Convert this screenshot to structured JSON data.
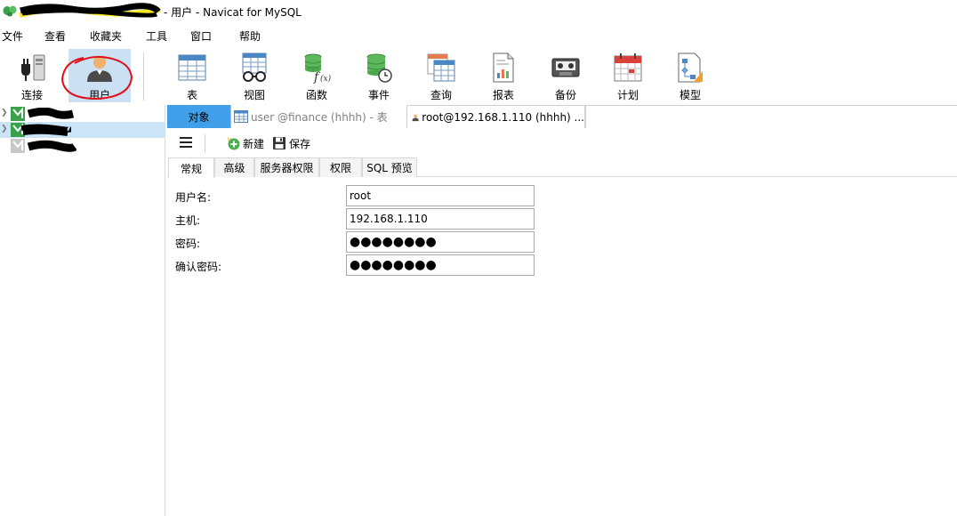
{
  "window": {
    "title_suffix": "- 用户 - Navicat for MySQL"
  },
  "menu": {
    "items": [
      "文件",
      "查看",
      "收藏夹",
      "工具",
      "窗口",
      "帮助"
    ]
  },
  "toolbar": {
    "connect": "连接",
    "user": "用户",
    "table": "表",
    "view": "视图",
    "function": "函数",
    "event": "事件",
    "query": "查询",
    "report": "报表",
    "backup": "备份",
    "schedule": "计划",
    "model": "模型"
  },
  "tabs": {
    "objects": "对象",
    "table_tab": "user @finance (hhhh) - 表",
    "user_tab": "root@192.168.1.110 (hhhh) ..."
  },
  "subtoolbar": {
    "new": "新建",
    "save": "保存"
  },
  "property_tabs": [
    "常规",
    "高级",
    "服务器权限",
    "权限",
    "SQL 预览"
  ],
  "form": {
    "username_label": "用户名:",
    "username_value": "root",
    "host_label": "主机:",
    "host_value": "192.168.1.110",
    "password_label": "密码:",
    "password_value": "●●●●●●●●",
    "confirm_label": "确认密码:",
    "confirm_value": "●●●●●●●●"
  },
  "colors": {
    "accent": "#42a0ea",
    "selected": "#cce0f4",
    "redaction": "#000000",
    "highlight": "#f5ea20",
    "scribble": "#e0101a"
  }
}
